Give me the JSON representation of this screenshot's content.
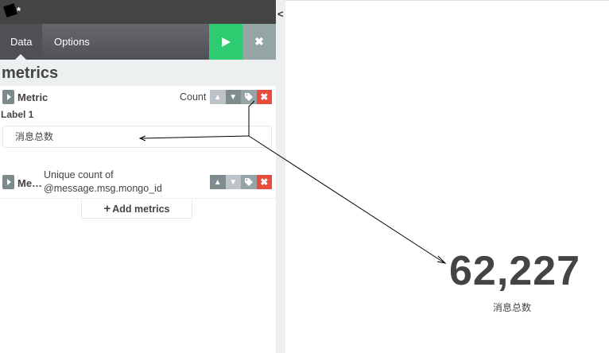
{
  "window": {
    "title": "*"
  },
  "tabs": [
    {
      "label": "Data",
      "active": true
    },
    {
      "label": "Options",
      "active": false
    }
  ],
  "toolbar": {
    "apply_icon": "play-icon",
    "discard_icon": "close-icon"
  },
  "section": {
    "title": "metrics"
  },
  "aggregations": [
    {
      "label": "Metric",
      "type": "Count",
      "field_label_title": "Label 1",
      "custom_label": "消息总数",
      "buttons": [
        "chevron-up-icon",
        "chevron-down-icon",
        "tag-icon",
        "remove-icon"
      ]
    },
    {
      "label": "Me…",
      "description_line1": "Unique count of",
      "description_line2": "@message.msg.mongo_id",
      "buttons": [
        "chevron-up-icon",
        "chevron-down-icon",
        "tag-icon",
        "remove-icon"
      ]
    }
  ],
  "add_metrics": {
    "label": "Add metrics",
    "icon": "plus-icon"
  },
  "splitter": {
    "icon": "chevron-left-icon"
  },
  "visualization": {
    "value": "62,227",
    "label": "消息总数"
  },
  "colors": {
    "run": "#2ecc71",
    "remove": "#e74c3c",
    "tabbar": "#505057",
    "panel_bg": "#ecf0f1",
    "text": "#444444"
  }
}
